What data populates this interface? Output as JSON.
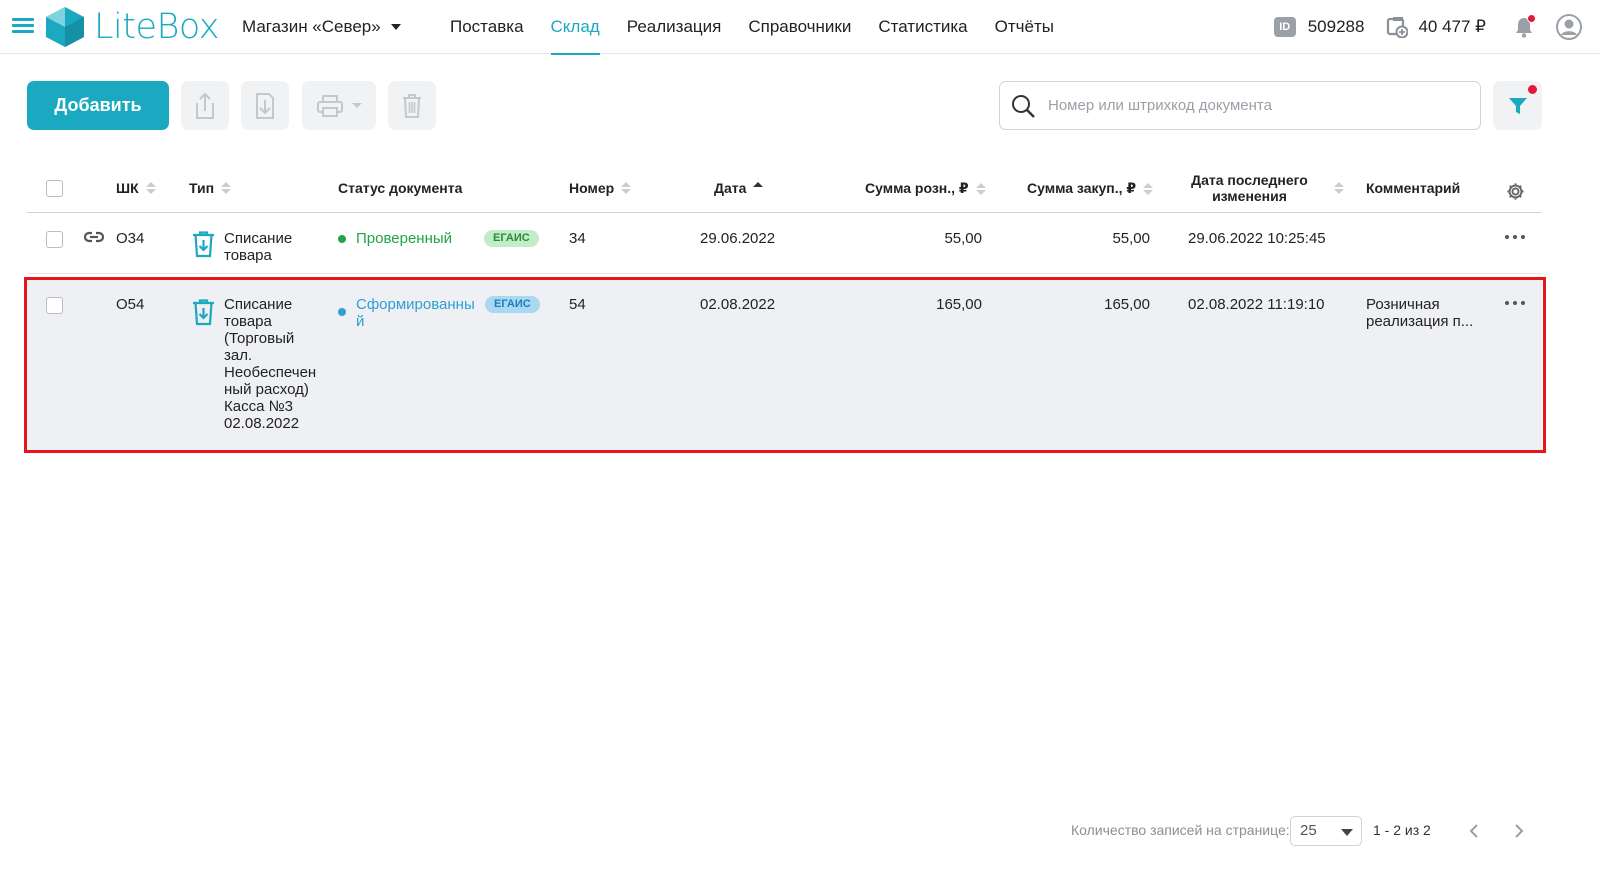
{
  "app": {
    "logo_text": "LiteBox"
  },
  "header": {
    "store_name": "Магазин «Север»",
    "nav": [
      {
        "label": "Поставка",
        "active": false
      },
      {
        "label": "Склад",
        "active": true
      },
      {
        "label": "Реализация",
        "active": false
      },
      {
        "label": "Справочники",
        "active": false
      },
      {
        "label": "Статистика",
        "active": false
      },
      {
        "label": "Отчёты",
        "active": false
      }
    ],
    "id_badge": "ID",
    "account_id": "509288",
    "balance": "40 477 ₽",
    "icons": {
      "menu": "hamburger-icon",
      "balance": "wallet-icon",
      "notifications": "bell-icon",
      "profile": "user-icon"
    }
  },
  "toolbar": {
    "add_label": "Добавить",
    "buttons": [
      "export-icon",
      "import-icon",
      "print-icon",
      "delete-icon"
    ],
    "search_placeholder": "Номер или штрихкод документа",
    "filter": "filter-icon"
  },
  "table": {
    "columns": {
      "barcode": "ШК",
      "type": "Тип",
      "status": "Статус документа",
      "number": "Номер",
      "date": "Дата",
      "retail_sum": "Сумма розн., ₽",
      "purchase_sum": "Сумма закуп., ₽",
      "modified_line1": "Дата последнего",
      "modified_line2": "изменения",
      "comment": "Комментарий"
    },
    "rows": [
      {
        "barcode": "O34",
        "type_line1": "Списание",
        "type_line2": "товара",
        "status": "Проверенный",
        "status_color": "#22a447",
        "badge": "ЕГАИС",
        "number": "34",
        "date": "29.06.2022",
        "retail_sum": "55,00",
        "purchase_sum": "55,00",
        "modified": "29.06.2022 10:25:45",
        "comment_line1": "",
        "comment_line2": ""
      },
      {
        "barcode": "O54",
        "type_lines": [
          "Списание",
          "товара",
          "(Торговый",
          "зал.",
          "Необеспечен",
          "ный расход)",
          "Касса №3",
          "02.08.2022"
        ],
        "status_line1": "Сформированны",
        "status_line2": "й",
        "status_color": "#2f9fd6",
        "badge": "ЕГАИС",
        "number": "54",
        "date": "02.08.2022",
        "retail_sum": "165,00",
        "purchase_sum": "165,00",
        "modified": "02.08.2022 11:19:10",
        "comment_line1": "Розничная",
        "comment_line2": "реализация п..."
      }
    ]
  },
  "pagination": {
    "per_page_label": "Количество записей на странице:",
    "per_page": "25",
    "range": "1 - 2 из 2"
  }
}
